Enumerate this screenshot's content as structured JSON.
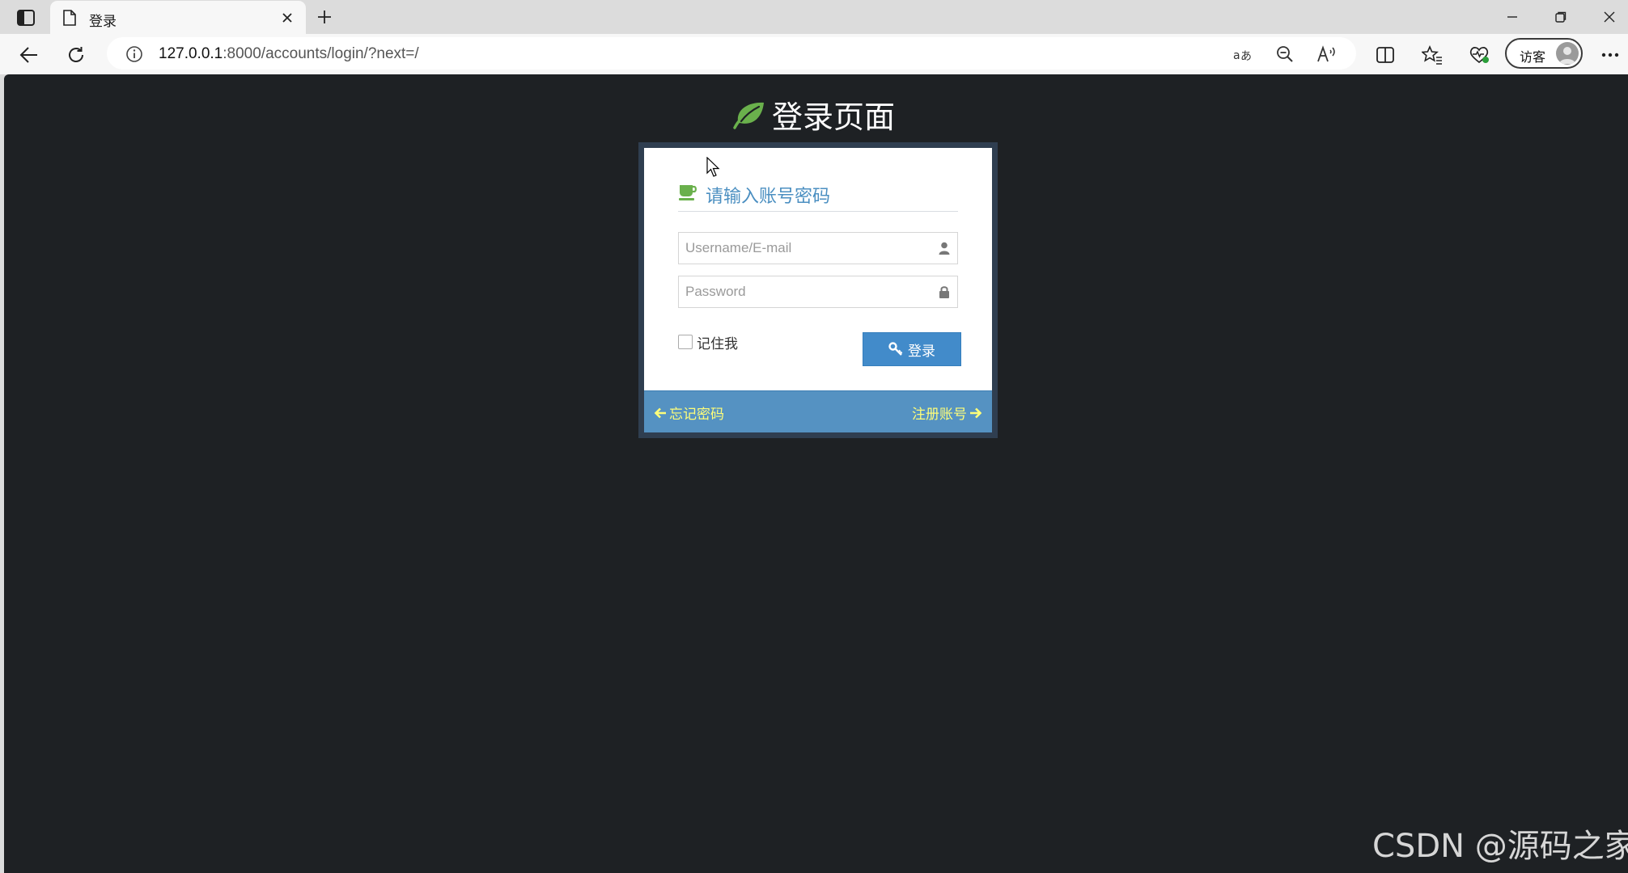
{
  "browser": {
    "tab": {
      "title": "登录"
    },
    "address": {
      "url_host": "127.0.0.1",
      "url_rest": ":8000/accounts/login/?next=/"
    },
    "profile": {
      "label": "访客"
    }
  },
  "page": {
    "heading": "登录页面",
    "login_box": {
      "title": "请输入账号密码",
      "username": {
        "placeholder": "Username/E-mail",
        "value": ""
      },
      "password": {
        "placeholder": "Password",
        "value": ""
      },
      "remember_label": "记住我",
      "remember_checked": false,
      "login_button_label": "登录",
      "forgot_link": "忘记密码",
      "register_link": "注册账号"
    }
  },
  "watermark": "CSDN @源码之家",
  "colors": {
    "page_bg": "#1e2124",
    "box_border": "#2f3e50",
    "title_text": "#4b8fc1",
    "button": "#428bca",
    "footer_bar": "#5592c2",
    "footer_links": "#fdfd7a",
    "leaf_green": "#6ab04c"
  },
  "icons": {
    "heading": "leaf-icon",
    "title": "coffee-icon",
    "username": "user-icon",
    "password": "lock-icon",
    "login_button": "key-icon",
    "forgot": "arrow-left-icon",
    "register": "arrow-right-icon"
  }
}
